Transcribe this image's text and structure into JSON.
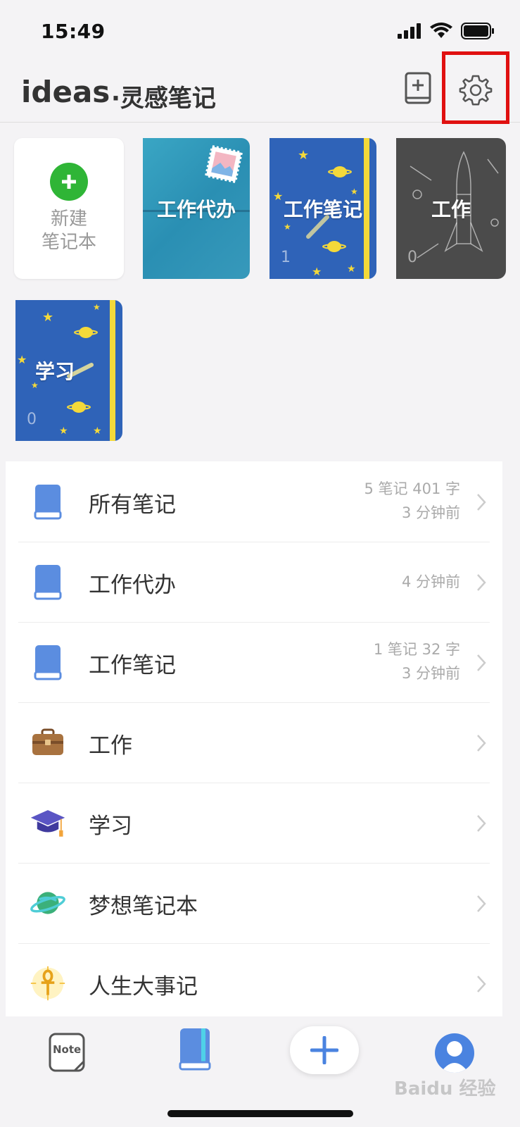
{
  "status_bar": {
    "time": "15:49"
  },
  "header": {
    "title": "ideas",
    "subtitle": "·灵感笔记"
  },
  "notebooks_grid": {
    "new_label_line1": "新建",
    "new_label_line2": "笔记本",
    "covers": [
      {
        "title": "工作代办",
        "count": ""
      },
      {
        "title": "工作笔记",
        "count": "1"
      },
      {
        "title": "工作",
        "count": "0"
      },
      {
        "title": "学习",
        "count": "0"
      }
    ]
  },
  "list": {
    "items": [
      {
        "label": "所有笔记",
        "meta1": "5 笔记 401 字",
        "meta2": "3 分钟前",
        "icon": "blue-book-icon"
      },
      {
        "label": "工作代办",
        "meta1": "4 分钟前",
        "meta2": "",
        "icon": "blue-book-icon"
      },
      {
        "label": "工作笔记",
        "meta1": "1 笔记 32 字",
        "meta2": "3 分钟前",
        "icon": "blue-book-icon"
      },
      {
        "label": "工作",
        "meta1": "",
        "meta2": "",
        "icon": "briefcase-icon"
      },
      {
        "label": "学习",
        "meta1": "",
        "meta2": "",
        "icon": "graduation-cap-icon"
      },
      {
        "label": "梦想笔记本",
        "meta1": "",
        "meta2": "",
        "icon": "planet-icon"
      },
      {
        "label": "人生大事记",
        "meta1": "",
        "meta2": "",
        "icon": "ankh-icon"
      }
    ]
  },
  "tabbar": {
    "note_icon_text": "Note"
  },
  "watermark": "Baidu 经验",
  "colors": {
    "accent": "#4a83e0",
    "green": "#2fb536",
    "highlight": "#e01010"
  }
}
